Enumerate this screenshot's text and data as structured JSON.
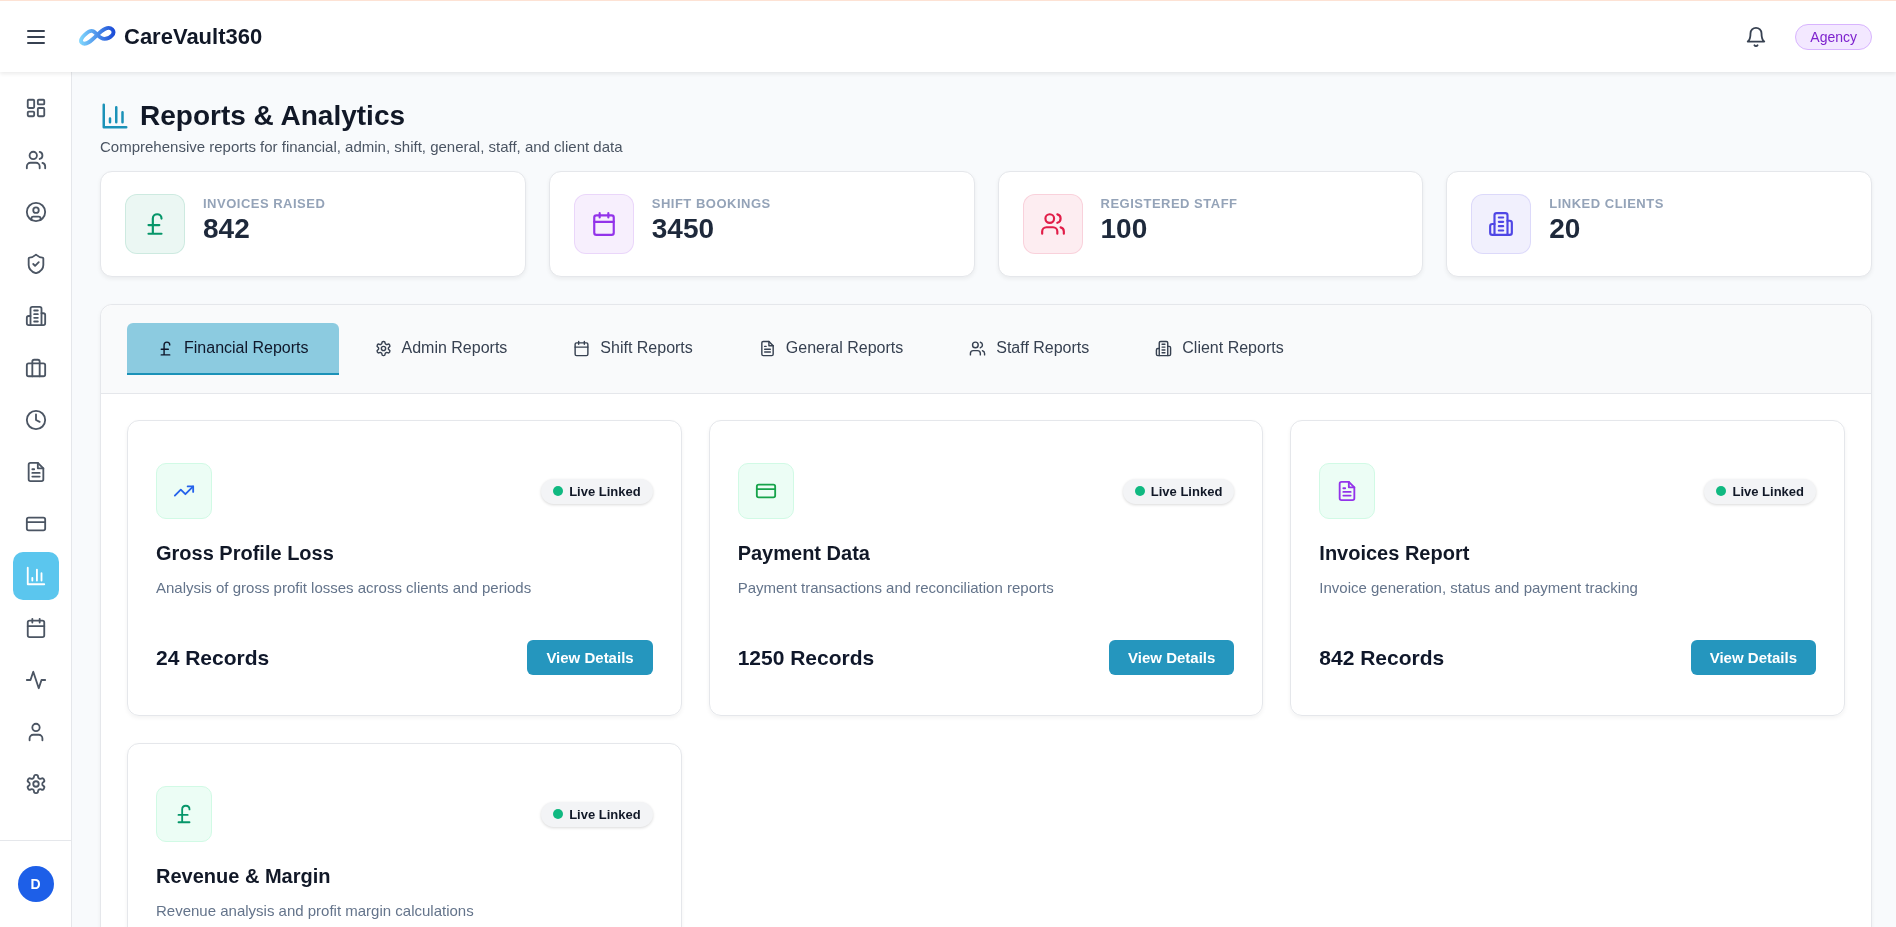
{
  "header": {
    "brand": "CareVault360",
    "role_badge": "Agency"
  },
  "sidebar": {
    "items": [
      {
        "selected": false
      },
      {
        "selected": false
      },
      {
        "selected": false
      },
      {
        "selected": false
      },
      {
        "selected": false
      },
      {
        "selected": false
      },
      {
        "selected": false
      },
      {
        "selected": false
      },
      {
        "selected": false
      },
      {
        "selected": true
      },
      {
        "selected": false
      },
      {
        "selected": false
      },
      {
        "selected": false
      },
      {
        "selected": false
      }
    ],
    "avatar": "D"
  },
  "page": {
    "title": "Reports & Analytics",
    "subtitle": "Comprehensive reports for financial, admin, shift, general, staff, and client data"
  },
  "stats": [
    {
      "label": "INVOICES RAISED",
      "value": "842",
      "color": "#059669"
    },
    {
      "label": "SHIFT BOOKINGS",
      "value": "3450",
      "color": "#9333ea"
    },
    {
      "label": "REGISTERED STAFF",
      "value": "100",
      "color": "#e11d48"
    },
    {
      "label": "LINKED CLIENTS",
      "value": "20",
      "color": "#4f46e5"
    }
  ],
  "tabs": [
    {
      "label": "Financial Reports",
      "selected": true
    },
    {
      "label": "Admin Reports",
      "selected": false
    },
    {
      "label": "Shift Reports",
      "selected": false
    },
    {
      "label": "General Reports",
      "selected": false
    },
    {
      "label": "Staff Reports",
      "selected": false
    },
    {
      "label": "Client Reports",
      "selected": false
    }
  ],
  "reports": [
    {
      "title": "Gross Profile Loss",
      "description": "Analysis of gross profit losses across clients and periods",
      "records": "24 Records",
      "status": "Live Linked",
      "button": "View Details",
      "color": "#2563eb"
    },
    {
      "title": "Payment Data",
      "description": "Payment transactions and reconciliation reports",
      "records": "1250 Records",
      "status": "Live Linked",
      "button": "View Details",
      "color": "#16a34a"
    },
    {
      "title": "Invoices Report",
      "description": "Invoice generation, status and payment tracking",
      "records": "842 Records",
      "status": "Live Linked",
      "button": "View Details",
      "color": "#9333ea"
    },
    {
      "title": "Revenue & Margin",
      "description": "Revenue analysis and profit margin calculations",
      "status": "Live Linked",
      "color": "#059669"
    }
  ]
}
